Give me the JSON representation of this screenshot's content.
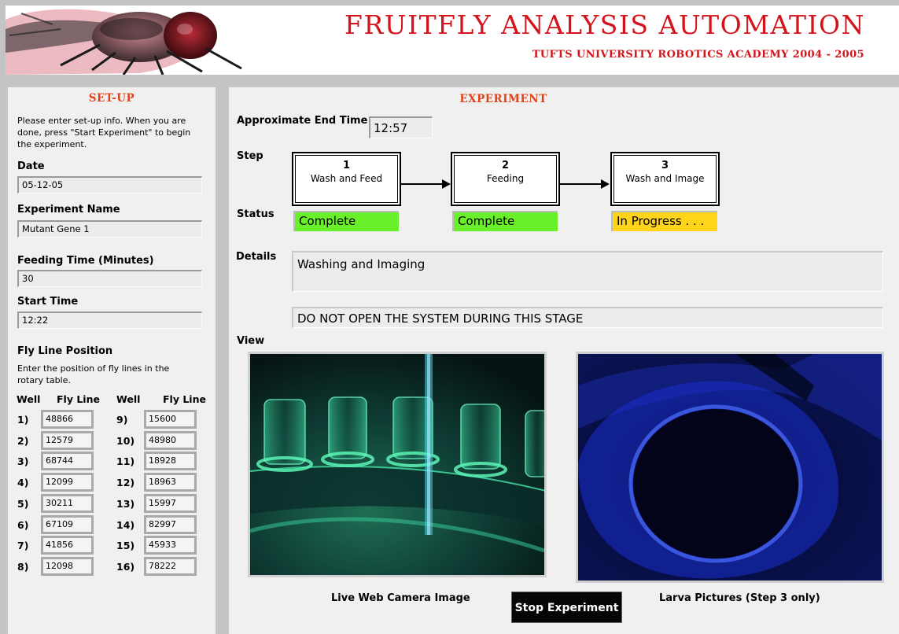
{
  "banner": {
    "title": "FRUITFLY ANALYSIS AUTOMATION",
    "subtitle": "TUFTS UNIVERSITY ROBOTICS ACADEMY 2004 - 2005"
  },
  "setup": {
    "heading": "SET-UP",
    "instructions": "Please enter set-up info. When you are done, press \"Start Experiment\" to begin the experiment.",
    "date_label": "Date",
    "date_value": "05-12-05",
    "experiment_name_label": "Experiment Name",
    "experiment_name_value": "Mutant Gene 1",
    "feeding_time_label": "Feeding Time (Minutes)",
    "feeding_time_value": "30",
    "start_time_label": "Start Time",
    "start_time_value": "12:22",
    "fly_line_position_label": "Fly Line Position",
    "fly_line_instructions": "Enter the position of fly lines in the rotary table.",
    "col_well": "Well",
    "col_fly_line": "Fly Line",
    "wells_left": [
      {
        "well": "1)",
        "line": "48866"
      },
      {
        "well": "2)",
        "line": "12579"
      },
      {
        "well": "3)",
        "line": "68744"
      },
      {
        "well": "4)",
        "line": "12099"
      },
      {
        "well": "5)",
        "line": "30211"
      },
      {
        "well": "6)",
        "line": "67109"
      },
      {
        "well": "7)",
        "line": "41856"
      },
      {
        "well": "8)",
        "line": "12098"
      }
    ],
    "wells_right": [
      {
        "well": "9)",
        "line": "15600"
      },
      {
        "well": "10)",
        "line": "48980"
      },
      {
        "well": "11)",
        "line": "18928"
      },
      {
        "well": "12)",
        "line": "18963"
      },
      {
        "well": "13)",
        "line": "15997"
      },
      {
        "well": "14)",
        "line": "82997"
      },
      {
        "well": "15)",
        "line": "45933"
      },
      {
        "well": "16)",
        "line": "78222"
      }
    ]
  },
  "experiment": {
    "heading": "EXPERIMENT",
    "end_time_label": "Approximate End Time",
    "end_time_value": "12:57",
    "step_label": "Step",
    "status_label": "Status",
    "details_label": "Details",
    "view_label": "View",
    "steps": [
      {
        "num": "1",
        "name": "Wash and Feed",
        "status": "Complete"
      },
      {
        "num": "2",
        "name": "Feeding",
        "status": "Complete"
      },
      {
        "num": "3",
        "name": "Wash and Image",
        "status": "In Progress . . ."
      }
    ],
    "details_text": "Washing and Imaging",
    "warning_text": "DO NOT OPEN THE SYSTEM DURING THIS STAGE",
    "camera_caption": "Live Web Camera Image",
    "larva_caption": "Larva Pictures (Step 3 only)",
    "stop_button": "Stop Experiment"
  },
  "colors": {
    "title_red": "#d4141b",
    "section_orange": "#e0431c",
    "status_complete": "#6af02a",
    "status_in_progress": "#ffd51c"
  },
  "icons": [
    "fly-logo-icon",
    "arrow-right-icon"
  ]
}
